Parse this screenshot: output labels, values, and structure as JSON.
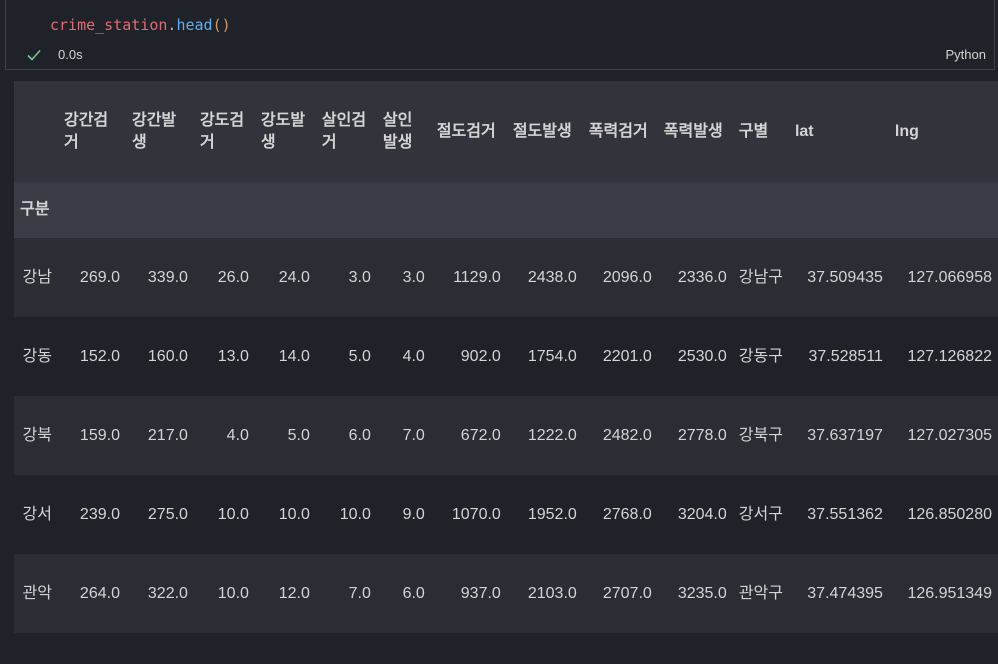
{
  "cell": {
    "code": {
      "var": "crime_station",
      "dot": ".",
      "fn": "head",
      "parens": "()"
    },
    "exec_time": "0.0s",
    "language": "Python",
    "status_icon": "check-icon",
    "status_color": "#73c991"
  },
  "table": {
    "columns": [
      "강간검거",
      "강간발생",
      "강도검거",
      "강도발생",
      "살인검거",
      "살인발생",
      "절도검거",
      "절도발생",
      "폭력검거",
      "폭력발생",
      "구별",
      "lat",
      "lng"
    ],
    "index_name": "구분",
    "rows": [
      {
        "index": "강남",
        "values": [
          "269.0",
          "339.0",
          "26.0",
          "24.0",
          "3.0",
          "3.0",
          "1129.0",
          "2438.0",
          "2096.0",
          "2336.0",
          "강남구",
          "37.509435",
          "127.066958"
        ]
      },
      {
        "index": "강동",
        "values": [
          "152.0",
          "160.0",
          "13.0",
          "14.0",
          "5.0",
          "4.0",
          "902.0",
          "1754.0",
          "2201.0",
          "2530.0",
          "강동구",
          "37.528511",
          "127.126822"
        ]
      },
      {
        "index": "강북",
        "values": [
          "159.0",
          "217.0",
          "4.0",
          "5.0",
          "6.0",
          "7.0",
          "672.0",
          "1222.0",
          "2482.0",
          "2778.0",
          "강북구",
          "37.637197",
          "127.027305"
        ]
      },
      {
        "index": "강서",
        "values": [
          "239.0",
          "275.0",
          "10.0",
          "10.0",
          "10.0",
          "9.0",
          "1070.0",
          "1952.0",
          "2768.0",
          "3204.0",
          "강서구",
          "37.551362",
          "126.850280"
        ]
      },
      {
        "index": "관악",
        "values": [
          "264.0",
          "322.0",
          "10.0",
          "12.0",
          "7.0",
          "6.0",
          "937.0",
          "2103.0",
          "2707.0",
          "3235.0",
          "관악구",
          "37.474395",
          "126.951349"
        ]
      }
    ]
  }
}
